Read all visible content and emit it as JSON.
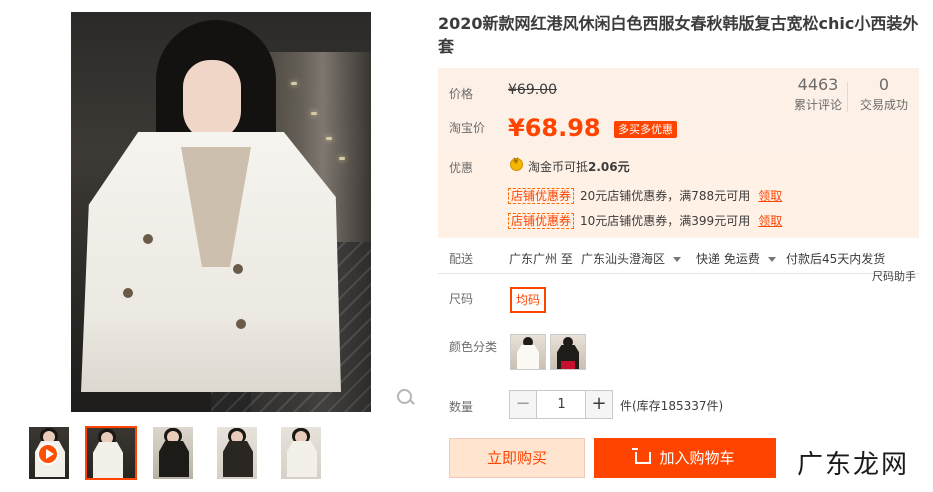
{
  "product": {
    "title": "2020新款网红港风休闲白色西服女春秋韩版复古宽松chic小西装外套"
  },
  "price": {
    "orig_label": "价格",
    "orig_value": "¥69.00",
    "taobao_label": "淘宝价",
    "currency": "¥",
    "current_value": "68.98",
    "promo_tag": "多买多优惠"
  },
  "stats": [
    {
      "num": "4463",
      "cap": "累计评论"
    },
    {
      "num": "0",
      "cap": "交易成功"
    }
  ],
  "discount": {
    "label": "优惠",
    "coin_text_prefix": "淘金币可抵",
    "coin_amount": "2.06元",
    "coupons": [
      {
        "tag": "店铺优惠券",
        "text": "20元店铺优惠券，满788元可用",
        "link": "领取"
      },
      {
        "tag": "店铺优惠券",
        "text": "10元店铺优惠券，满399元可用",
        "link": "领取"
      }
    ]
  },
  "shipping": {
    "label": "配送",
    "from": "广东广州 至",
    "to": "广东汕头澄海区",
    "method": "快递 免运费",
    "eta": "付款后45天内发货"
  },
  "size": {
    "helper": "尺码助手",
    "label": "尺码",
    "option": "均码"
  },
  "color": {
    "label": "颜色分类",
    "options": [
      "white-coat-swatch",
      "black-coat-swatch"
    ]
  },
  "quantity": {
    "label": "数量",
    "minus": "−",
    "value": "1",
    "plus": "+",
    "stock": "件(库存185337件)"
  },
  "actions": {
    "buy_now": "立即购买",
    "add_cart": "加入购物车"
  },
  "watermark": "广东龙网"
}
